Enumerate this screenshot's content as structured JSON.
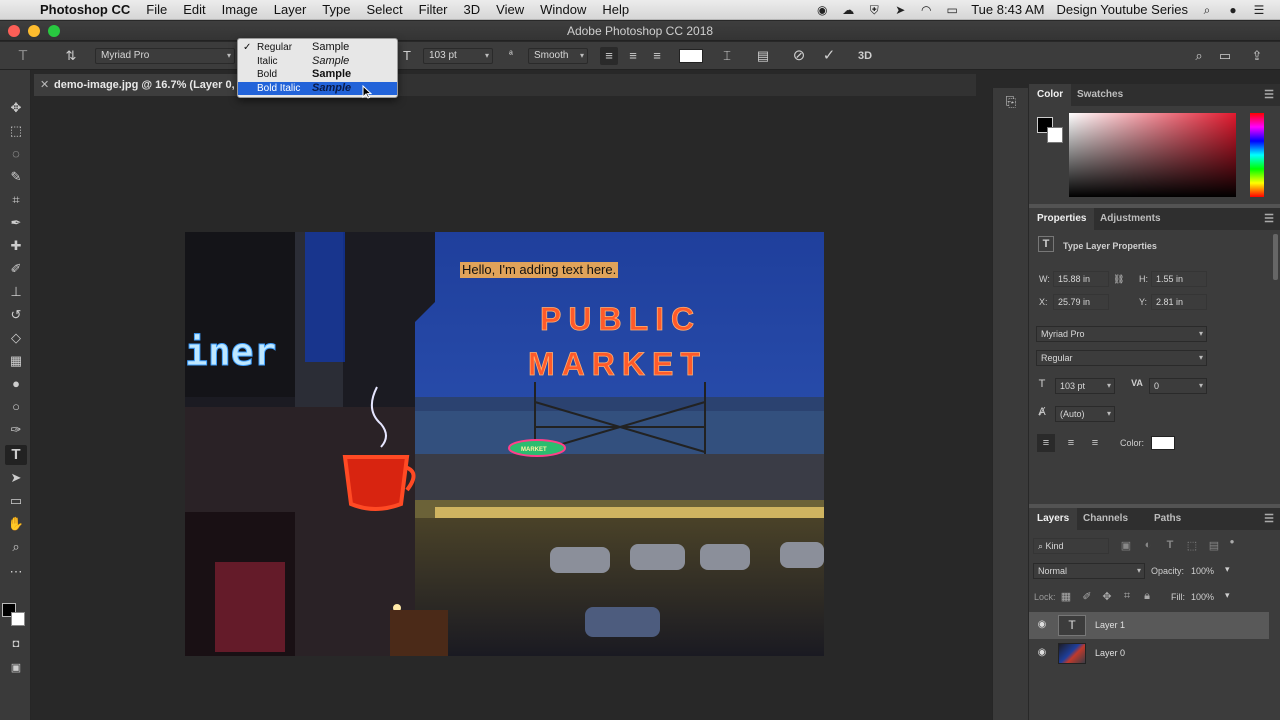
{
  "menubar": {
    "app_name": "Photoshop CC",
    "items": [
      "File",
      "Edit",
      "Image",
      "Layer",
      "Type",
      "Select",
      "Filter",
      "3D",
      "View",
      "Window",
      "Help"
    ],
    "clock": "Tue 8:43 AM",
    "user": "Design Youtube Series"
  },
  "window": {
    "title": "Adobe Photoshop CC 2018"
  },
  "options": {
    "font_family": "Myriad Pro",
    "font_size": "103 pt",
    "antialias": "Smooth"
  },
  "style_dropdown": {
    "items": [
      {
        "name": "Regular",
        "sample": "Sample",
        "checked": "✓"
      },
      {
        "name": "Italic",
        "sample": "Sample",
        "checked": ""
      },
      {
        "name": "Bold",
        "sample": "Sample",
        "checked": ""
      },
      {
        "name": "Bold Italic",
        "sample": "Sample",
        "checked": ""
      }
    ],
    "selected_index": 3
  },
  "document": {
    "tab_label": "demo-image.jpg @ 16.7% (Layer 0, R",
    "text_layer": "Hello, I'm adding text here.",
    "sign_line1": "PUBLIC",
    "sign_line2": "MARKET",
    "diner_sign": "iner",
    "fish_sign": "MARKET"
  },
  "color_panel": {
    "tabs": [
      "Color",
      "Swatches"
    ]
  },
  "properties_panel": {
    "tabs": [
      "Properties",
      "Adjustments"
    ],
    "header": "Type Layer Properties",
    "w_label": "W:",
    "w_value": "15.88 in",
    "h_label": "H:",
    "h_value": "1.55 in",
    "x_label": "X:",
    "x_value": "25.79 in",
    "y_label": "Y:",
    "y_value": "2.81 in",
    "font_family": "Myriad Pro",
    "font_style": "Regular",
    "size": "103 pt",
    "tracking": "0",
    "leading": "(Auto)",
    "color_label": "Color:"
  },
  "layers_panel": {
    "tabs": [
      "Layers",
      "Channels",
      "Paths"
    ],
    "filter_placeholder": "Kind",
    "blend_mode": "Normal",
    "opacity_label": "Opacity:",
    "opacity_value": "100%",
    "lock_label": "Lock:",
    "fill_label": "Fill:",
    "fill_value": "100%",
    "layers": [
      {
        "name": "Layer 1",
        "type": "text"
      },
      {
        "name": "Layer 0",
        "type": "image"
      }
    ]
  }
}
